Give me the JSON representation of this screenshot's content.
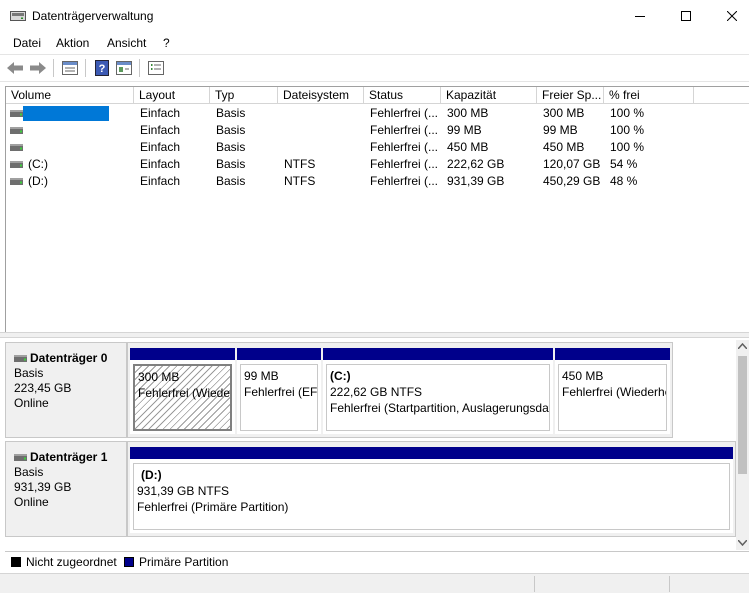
{
  "window": {
    "title": "Datenträgerverwaltung"
  },
  "menu": [
    "Datei",
    "Aktion",
    "Ansicht",
    "?"
  ],
  "toolbar": {
    "icons": [
      "back-arrow-icon",
      "forward-arrow-icon",
      "list-view-icon",
      "help-icon",
      "properties-icon",
      "settings-list-icon"
    ]
  },
  "table": {
    "columns": [
      "Volume",
      "Layout",
      "Typ",
      "Dateisystem",
      "Status",
      "Kapazität",
      "Freier Sp...",
      "% frei"
    ],
    "rows": [
      {
        "volume": "",
        "layout": "Einfach",
        "typ": "Basis",
        "fs": "",
        "status": "Fehlerfrei (...",
        "cap": "300 MB",
        "free": "300 MB",
        "pct": "100 %"
      },
      {
        "volume": "",
        "layout": "Einfach",
        "typ": "Basis",
        "fs": "",
        "status": "Fehlerfrei (...",
        "cap": "99 MB",
        "free": "99 MB",
        "pct": "100 %"
      },
      {
        "volume": "",
        "layout": "Einfach",
        "typ": "Basis",
        "fs": "",
        "status": "Fehlerfrei (...",
        "cap": "450 MB",
        "free": "450 MB",
        "pct": "100 %"
      },
      {
        "volume": "(C:)",
        "layout": "Einfach",
        "typ": "Basis",
        "fs": "NTFS",
        "status": "Fehlerfrei (...",
        "cap": "222,62 GB",
        "free": "120,07 GB",
        "pct": "54 %"
      },
      {
        "volume": "(D:)",
        "layout": "Einfach",
        "typ": "Basis",
        "fs": "NTFS",
        "status": "Fehlerfrei (...",
        "cap": "931,39 GB",
        "free": "450,29 GB",
        "pct": "48 %"
      }
    ]
  },
  "disks": [
    {
      "name": "Datenträger 0",
      "type": "Basis",
      "size": "223,45 GB",
      "state": "Online",
      "partitions": [
        {
          "title": "",
          "size": "300 MB",
          "status": "Fehlerfrei (Wiederherstellungspartition)"
        },
        {
          "title": "",
          "size": "99 MB",
          "status": "Fehlerfrei (EFI-Systempartition)"
        },
        {
          "title": "(C:)",
          "size": "222,62 GB NTFS",
          "status": "Fehlerfrei (Startpartition, Auslagerungsdatei, Absturzabbild, Primäre Partition)"
        },
        {
          "title": "",
          "size": "450 MB",
          "status": "Fehlerfrei (Wiederherstellungspartition)"
        }
      ]
    },
    {
      "name": "Datenträger 1",
      "type": "Basis",
      "size": "931,39 GB",
      "state": "Online",
      "partitions": [
        {
          "title": "(D:)",
          "size": "931,39 GB NTFS",
          "status": "Fehlerfrei (Primäre Partition)"
        }
      ]
    }
  ],
  "legend": [
    {
      "label": "Nicht zugeordnet",
      "color": "#000000"
    },
    {
      "label": "Primäre Partition",
      "color": "#00008b"
    }
  ],
  "colors": {
    "partition_bar": "#00008b",
    "selection": "#0078d7"
  }
}
